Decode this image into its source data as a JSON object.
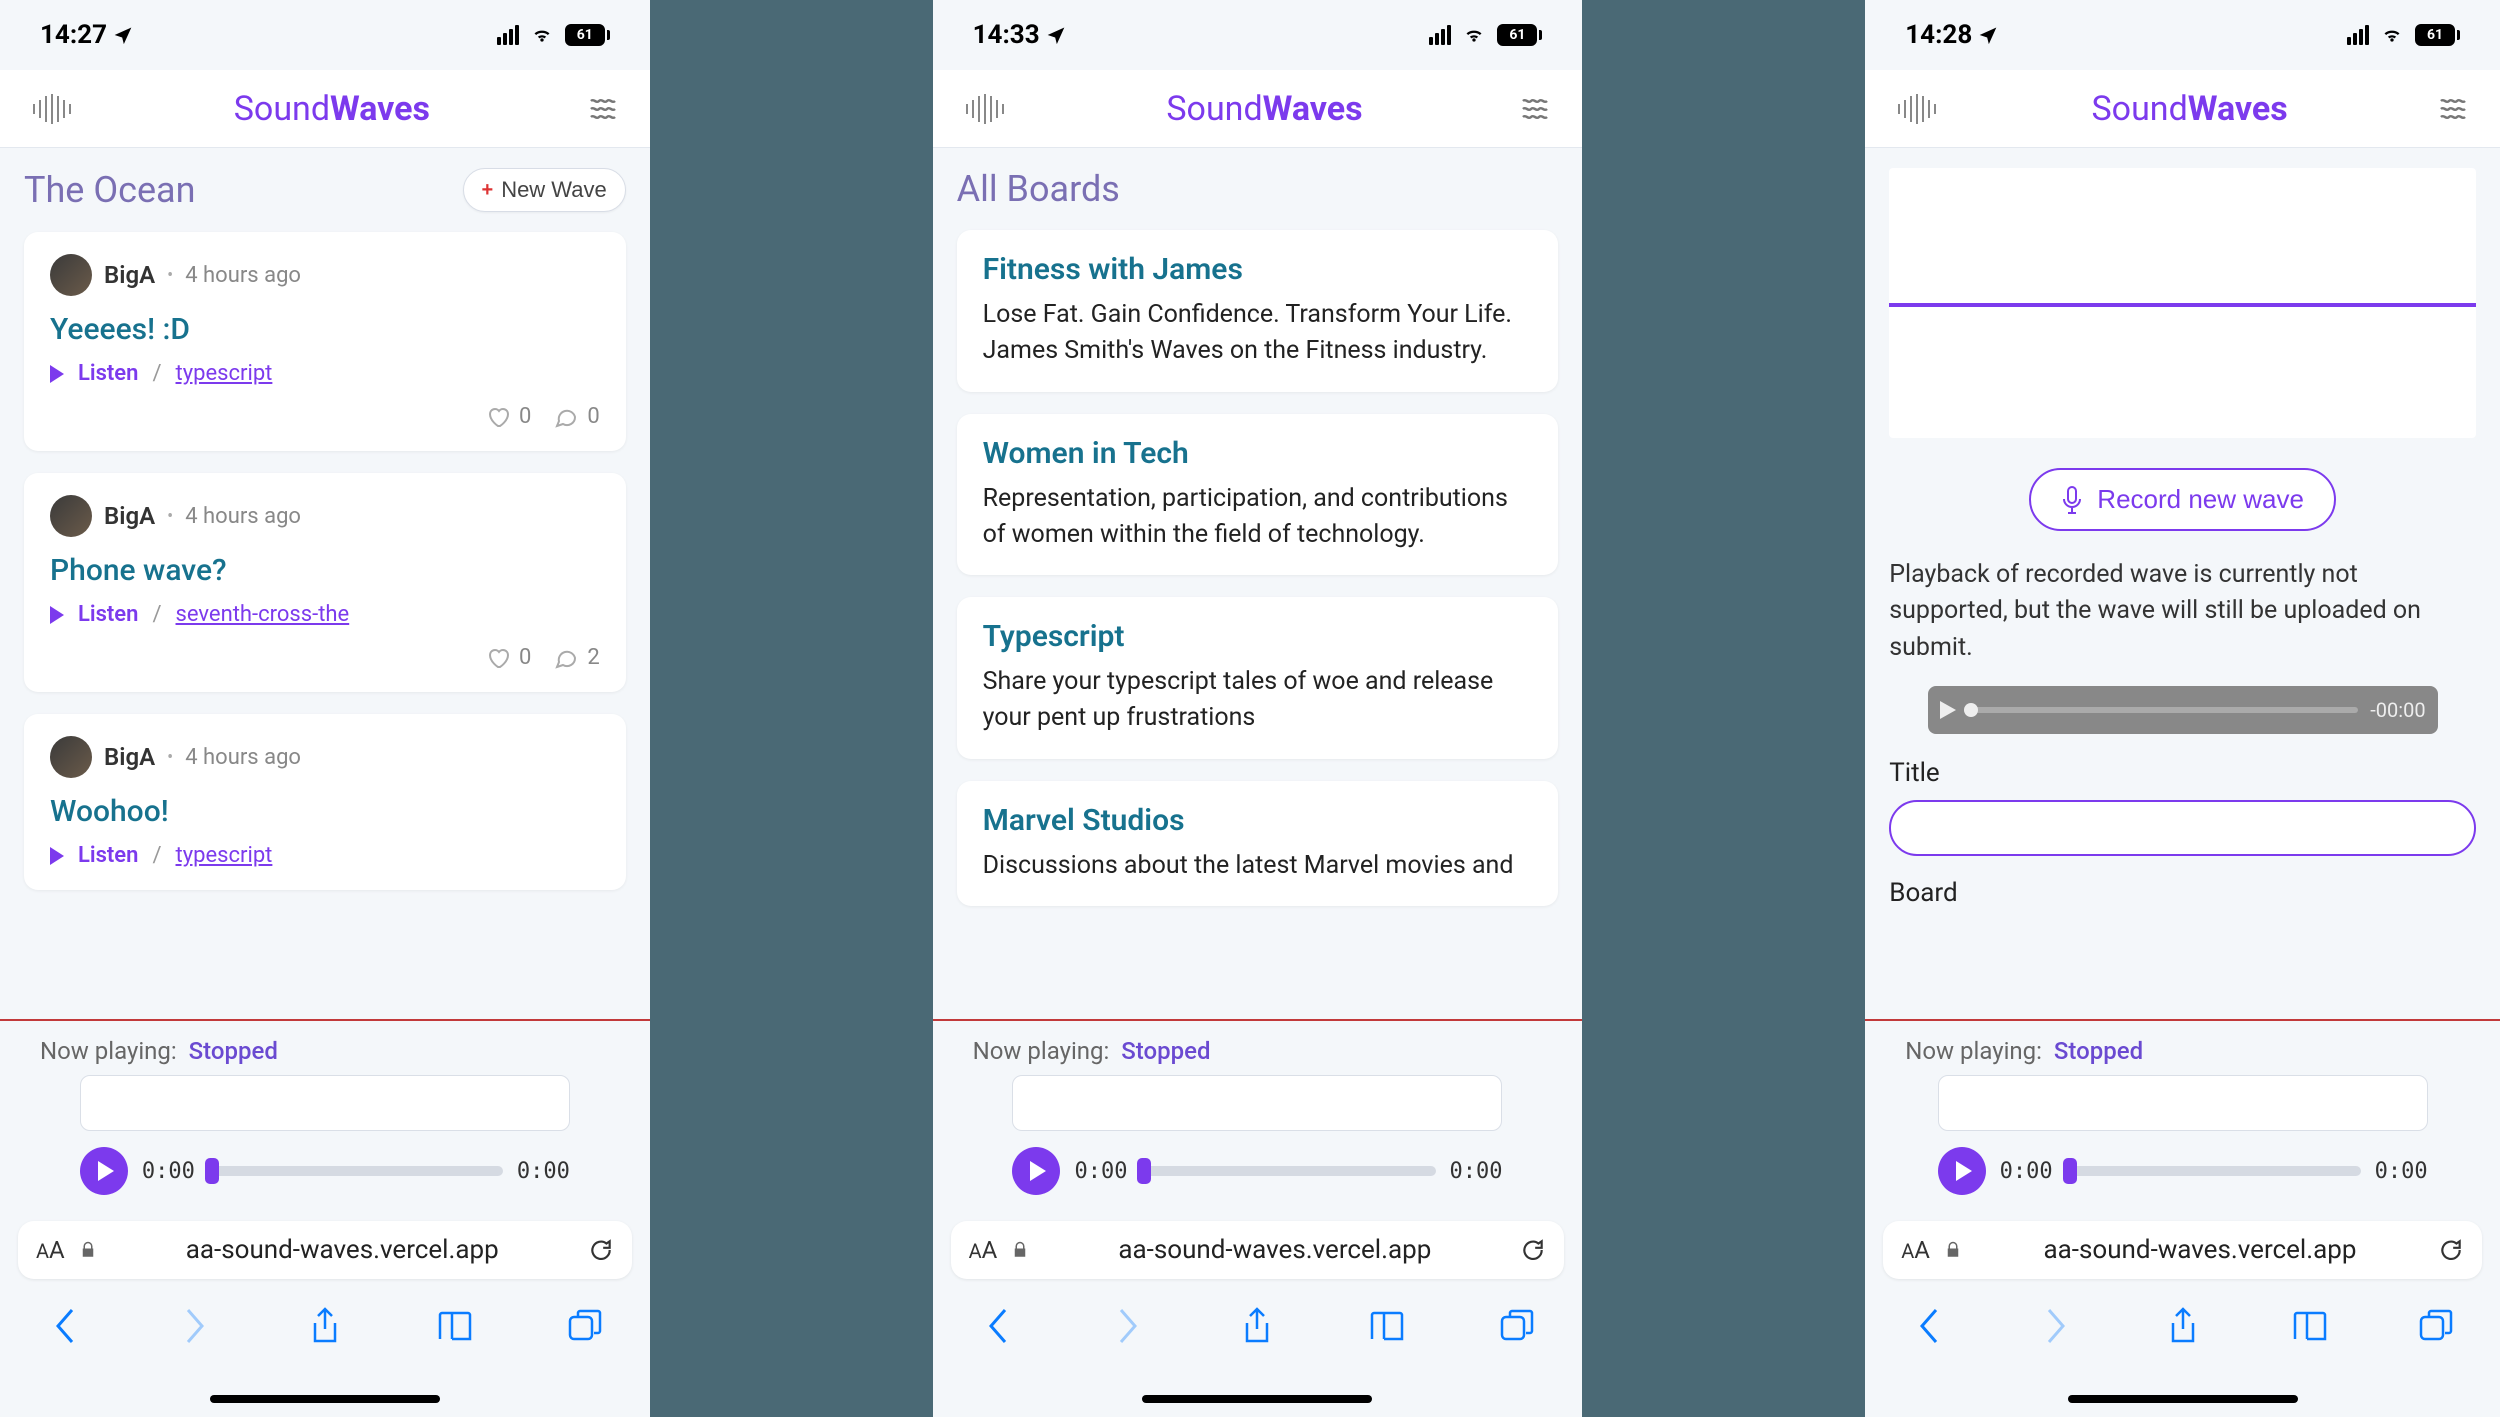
{
  "status": {
    "times": [
      "14:27",
      "14:33",
      "14:28"
    ],
    "battery": "61"
  },
  "brand": {
    "part1": "Sound",
    "part2": "Waves"
  },
  "screen1": {
    "heading": "The Ocean",
    "new_wave_label": "New Wave",
    "waves": [
      {
        "user": "BigA",
        "time": "4 hours ago",
        "title": "Yeeees! :D",
        "listen": "Listen",
        "link": "typescript",
        "likes": "0",
        "comments": "0"
      },
      {
        "user": "BigA",
        "time": "4 hours ago",
        "title": "Phone wave?",
        "listen": "Listen",
        "link": "seventh-cross-the",
        "likes": "0",
        "comments": "2"
      },
      {
        "user": "BigA",
        "time": "4 hours ago",
        "title": "Woohoo!",
        "listen": "Listen",
        "link": "typescript"
      }
    ]
  },
  "screen2": {
    "heading": "All Boards",
    "boards": [
      {
        "title": "Fitness with James",
        "desc": "Lose Fat. Gain Confidence. Transform Your Life. James Smith's Waves on the Fitness industry."
      },
      {
        "title": "Women in Tech",
        "desc": "Representation, participation, and contributions of women within the field of technology."
      },
      {
        "title": "Typescript",
        "desc": "Share your typescript tales of woe and release your pent up frustrations"
      },
      {
        "title": "Marvel Studios",
        "desc": "Discussions about the latest Marvel movies and"
      }
    ]
  },
  "screen3": {
    "record_label": "Record new wave",
    "help": "Playback of recorded wave is currently not supported, but the wave will still be uploaded on submit.",
    "audio_time": "-00:00",
    "title_label": "Title",
    "board_label": "Board"
  },
  "player": {
    "now_playing_label": "Now playing:",
    "status": "Stopped",
    "time_start": "0:00",
    "time_end": "0:00"
  },
  "safari": {
    "url": "aa-sound-waves.vercel.app"
  }
}
